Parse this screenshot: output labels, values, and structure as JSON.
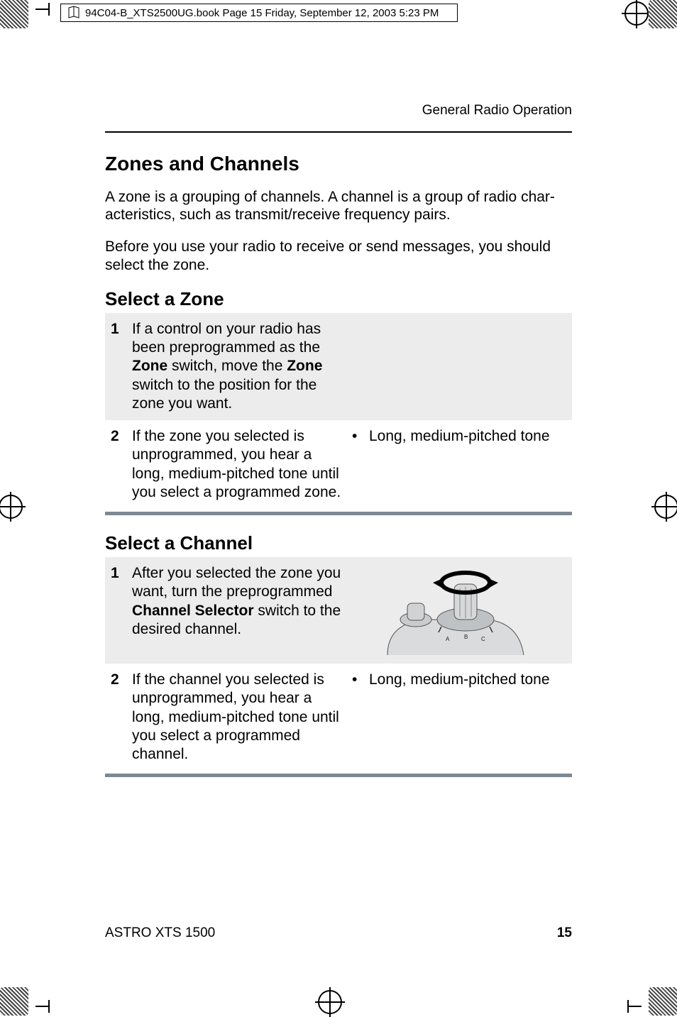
{
  "print_header": "94C04-B_XTS2500UG.book  Page 15  Friday, September 12, 2003  5:23 PM",
  "running_head": "General Radio Operation",
  "section_title": "Zones and Channels",
  "intro_para1": "A zone is a grouping of channels. A channel is a group of radio char-acteristics, such as transmit/receive frequency pairs.",
  "intro_para2": "Before you use your radio to receive or send messages, you should select the zone.",
  "zone": {
    "heading": "Select a Zone",
    "steps": [
      {
        "num": "1",
        "text_pre": "If a control on your radio has been preprogrammed as the ",
        "bold1": "Zone",
        "text_mid": " switch, move the ",
        "bold2": "Zone",
        "text_post": " switch to the position for the zone you want.",
        "result": ""
      },
      {
        "num": "2",
        "text": "If the zone you selected is unprogrammed, you hear a long, medium-pitched tone until you select a programmed zone.",
        "result": "Long, medium-pitched tone"
      }
    ]
  },
  "channel": {
    "heading": "Select a Channel",
    "steps": [
      {
        "num": "1",
        "text_pre": "After you selected the zone you want, turn the preprogrammed ",
        "bold1": "Channel Selector",
        "text_post": " switch to the desired channel.",
        "has_image": true
      },
      {
        "num": "2",
        "text": "If the channel you selected is unprogrammed, you hear a long, medium-pitched tone until you select a programmed channel.",
        "result": "Long, medium-pitched tone"
      }
    ]
  },
  "footer_left": "ASTRO XTS 1500",
  "footer_right": "15"
}
